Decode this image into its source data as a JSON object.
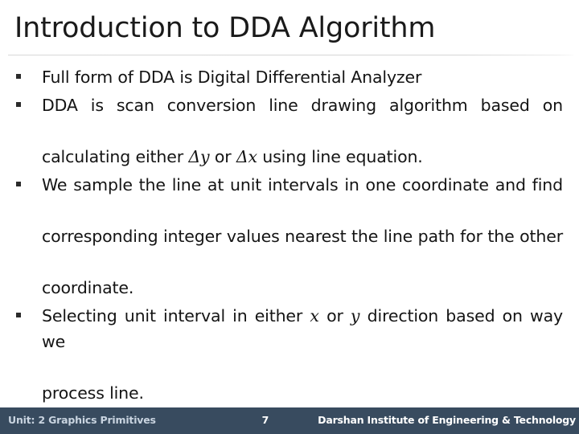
{
  "slide": {
    "title": "Introduction to DDA Algorithm",
    "background_color": "#ffffff",
    "title_color": "#1a1a1a",
    "divider_color": "#d8d8d8"
  },
  "bullets": [
    {
      "marker": "square-bullet",
      "lines": [
        {
          "segments": [
            {
              "type": "text",
              "value": "Full form of DDA is Digital Differential Analyzer"
            }
          ]
        }
      ],
      "justified": false,
      "plain_text": "Full form of DDA is Digital Differential Analyzer"
    },
    {
      "marker": "square-bullet",
      "lines": [
        {
          "segments": [
            {
              "type": "text",
              "value": "DDA is scan conversion line drawing algorithm based on"
            }
          ]
        },
        {
          "segments": [
            {
              "type": "text",
              "value": "calculating either "
            },
            {
              "type": "math",
              "value": "Δy"
            },
            {
              "type": "text",
              "value": " or "
            },
            {
              "type": "math",
              "value": "Δx"
            },
            {
              "type": "text",
              "value": " using line equation."
            }
          ]
        }
      ],
      "justified": true,
      "plain_text": "DDA is scan conversion line drawing algorithm based on calculating either Δy or Δx using line equation."
    },
    {
      "marker": "square-bullet",
      "lines": [
        {
          "segments": [
            {
              "type": "text",
              "value": "We sample the line at unit intervals in one coordinate and find"
            }
          ]
        },
        {
          "segments": [
            {
              "type": "text",
              "value": "corresponding integer values nearest the line path for the other"
            }
          ]
        },
        {
          "segments": [
            {
              "type": "text",
              "value": "coordinate."
            }
          ]
        }
      ],
      "justified": true,
      "plain_text": "We sample the line at unit intervals in one coordinate and find corresponding integer values nearest the line path for the other coordinate."
    },
    {
      "marker": "square-bullet",
      "lines": [
        {
          "segments": [
            {
              "type": "text",
              "value": "Selecting unit interval in either "
            },
            {
              "type": "math",
              "value": "x"
            },
            {
              "type": "text",
              "value": " or "
            },
            {
              "type": "math",
              "value": "y"
            },
            {
              "type": "text",
              "value": " direction based on way we"
            }
          ]
        },
        {
          "segments": [
            {
              "type": "text",
              "value": "process line."
            }
          ]
        }
      ],
      "justified": true,
      "plain_text": "Selecting unit interval in either x or y direction based on way we process line."
    }
  ],
  "bullet_text": {
    "b1_l1": "Full form of DDA is Digital Differential Analyzer",
    "b2_l1": "DDA is scan conversion line drawing algorithm based on",
    "b2_l2_pre": "calculating either ",
    "b2_l2_m1": "Δy",
    "b2_l2_mid": " or ",
    "b2_l2_m2": "Δx",
    "b2_l2_post": " using line equation.",
    "b3_l1": "We sample the line at unit intervals in one coordinate and find",
    "b3_l2": "corresponding integer values nearest the line path for the other",
    "b3_l3": "coordinate.",
    "b4_l1_pre": "Selecting unit interval in either ",
    "b4_l1_m1": "x",
    "b4_l1_mid": " or ",
    "b4_l1_m2": "y",
    "b4_l1_post": " direction based on way we",
    "b4_l2": "process line."
  },
  "footer": {
    "unit_label": "Unit: 2 Graphics Primitives",
    "page_number": "7",
    "organization": "Darshan Institute of Engineering & Technology",
    "background_color": "#384b5f",
    "unit_color": "#c9d4e0",
    "text_color": "#ffffff"
  }
}
